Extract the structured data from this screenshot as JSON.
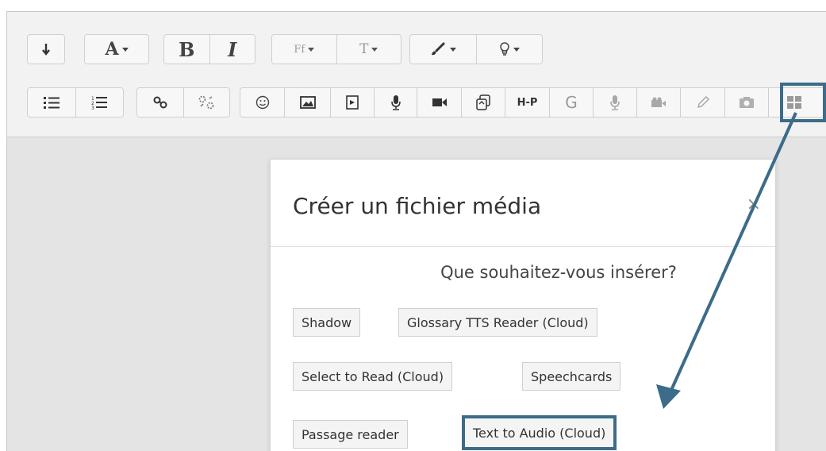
{
  "toolbar": {
    "row1": {
      "font_label": "A",
      "bold_label": "B",
      "italic_label": "I",
      "font_family_label": "Ff",
      "font_size_label": "T",
      "h5p_label": "H-P",
      "glossary_label": "G"
    }
  },
  "dialog": {
    "title": "Créer un fichier média",
    "close_label": "×",
    "question": "Que souhaitez-vous insérer?",
    "options": [
      "Shadow",
      "Glossary TTS Reader (Cloud)",
      "Select to Read (Cloud)",
      "Speechcards",
      "Passage reader",
      "Text to Audio (Cloud)"
    ]
  },
  "colors": {
    "highlight": "#3d6b8a",
    "toolbar_bg": "#f2f2f2",
    "editor_bg": "#e4e4e4"
  },
  "icons": [
    "collapse-icon",
    "font-color-icon",
    "bold-icon",
    "italic-icon",
    "font-family-icon",
    "font-size-icon",
    "brush-icon",
    "lightbulb-icon",
    "bullet-list-icon",
    "numbered-list-icon",
    "link-icon",
    "unlink-icon",
    "emoji-icon",
    "image-icon",
    "media-icon",
    "microphone-icon",
    "video-icon",
    "manage-files-icon",
    "h5p-icon",
    "glossary-icon",
    "record-audio-icon",
    "record-video-icon",
    "draw-icon",
    "screenshot-icon",
    "generico-icon"
  ]
}
